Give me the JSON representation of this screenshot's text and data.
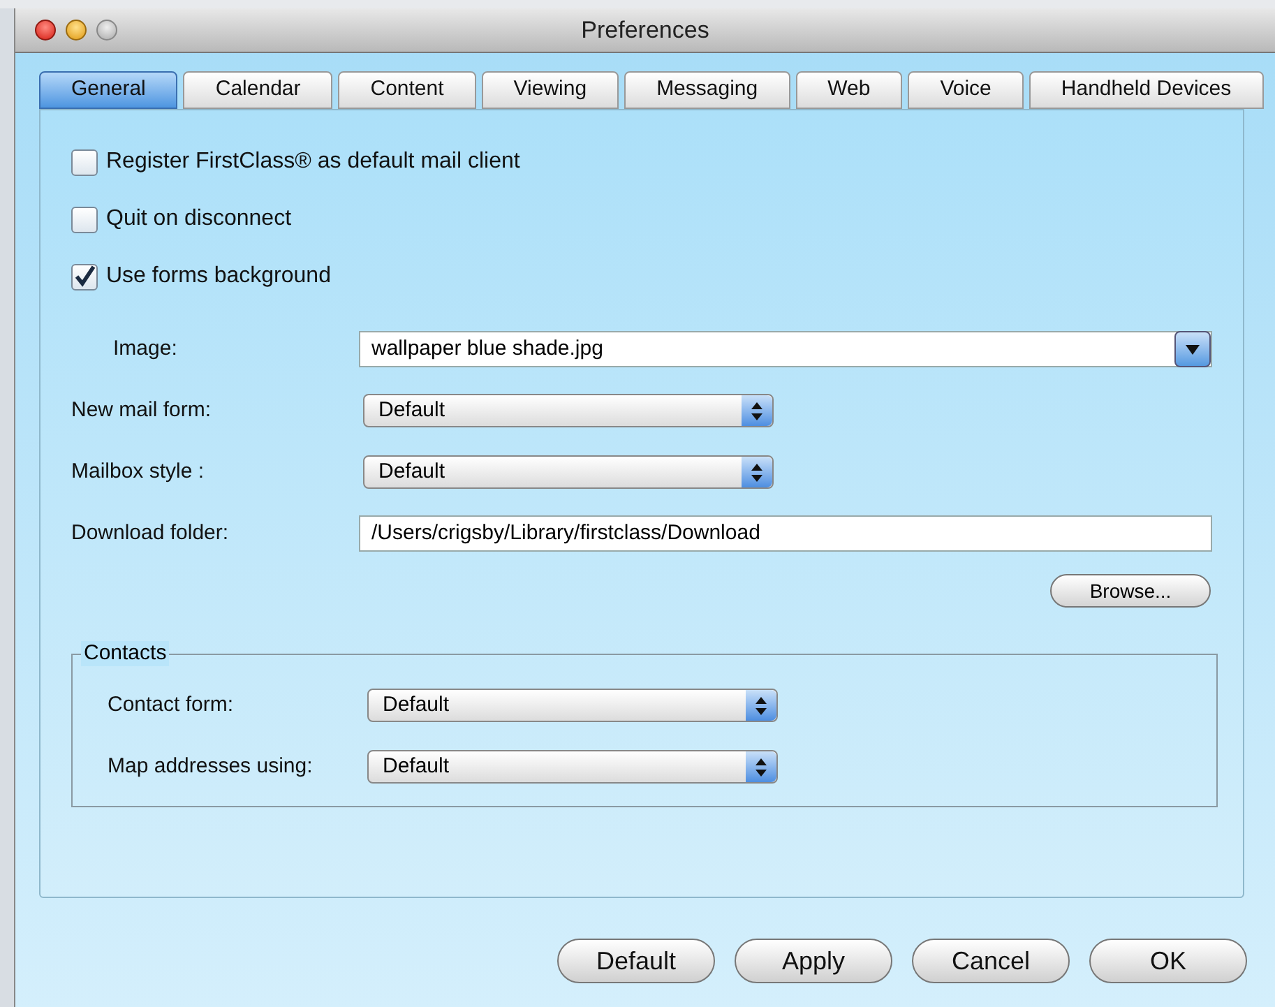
{
  "window": {
    "title": "Preferences"
  },
  "tabs": [
    {
      "label": "General",
      "selected": true
    },
    {
      "label": "Calendar",
      "selected": false
    },
    {
      "label": "Content",
      "selected": false
    },
    {
      "label": "Viewing",
      "selected": false
    },
    {
      "label": "Messaging",
      "selected": false
    },
    {
      "label": "Web",
      "selected": false
    },
    {
      "label": "Voice",
      "selected": false
    },
    {
      "label": "Handheld Devices",
      "selected": false
    }
  ],
  "checkboxes": [
    {
      "label": "Register FirstClass® as default mail client",
      "checked": false
    },
    {
      "label": "Quit on disconnect",
      "checked": false
    },
    {
      "label": "Use forms background",
      "checked": true
    }
  ],
  "fields": [
    {
      "kind": "combo",
      "label": "Image:",
      "value": "wallpaper blue shade.jpg"
    },
    {
      "kind": "popup",
      "label": "New mail form:",
      "value": "Default"
    },
    {
      "kind": "popup",
      "label": "Mailbox style :",
      "value": "Default"
    },
    {
      "kind": "text",
      "label": "Download folder:",
      "value": "/Users/crigsby/Library/firstclass/Download"
    }
  ],
  "browse_button": "Browse...",
  "contacts": {
    "title": "Contacts",
    "fields": [
      {
        "kind": "popup",
        "label": "Contact form:",
        "value": "Default"
      },
      {
        "kind": "popup",
        "label": "Map addresses using:",
        "value": "Default"
      }
    ]
  },
  "buttons": [
    "Default",
    "Apply",
    "Cancel",
    "OK"
  ]
}
